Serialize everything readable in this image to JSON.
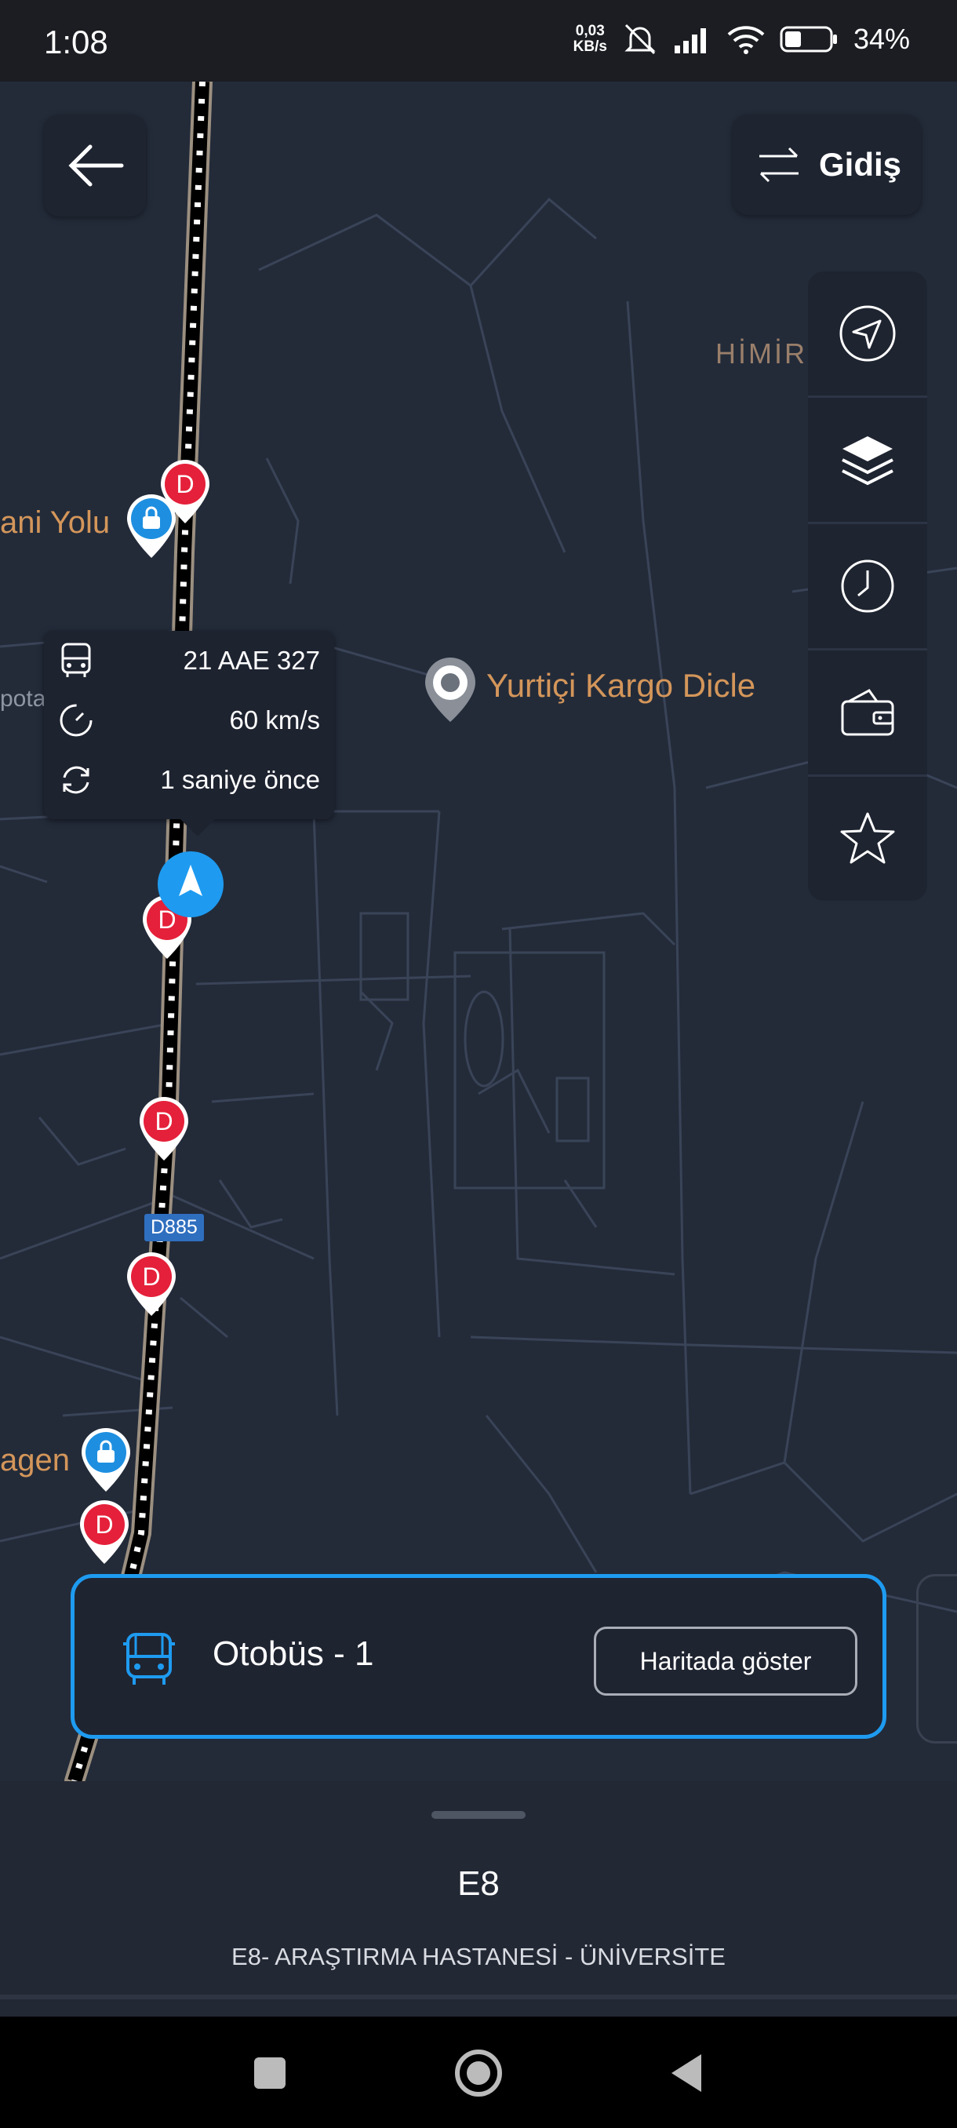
{
  "status_bar": {
    "time": "1:08",
    "net_speed_value": "0,03",
    "net_speed_unit": "KB/s",
    "battery": "34%"
  },
  "top_controls": {
    "direction_label": "Gidiş"
  },
  "map": {
    "road_labels": [
      "ani Yolu",
      "agen",
      "pota"
    ],
    "place_label": "Yurtiçi Kargo Dicle",
    "area_label": "HİMİR",
    "highway_shield": "D885",
    "stop_marker_letter": "D"
  },
  "vehicle_info": {
    "plate": "21 AAE 327",
    "speed": "60 km/s",
    "updated": "1 saniye önce"
  },
  "vehicle_card": {
    "name": "Otobüs - 1",
    "show_button": "Haritada göster"
  },
  "bottom_sheet": {
    "line_code": "E8",
    "route_name": "E8- ARAŞTIRMA HASTANESİ - ÜNİVERSİTE"
  },
  "colors": {
    "accent": "#1e9bf0",
    "stop_red": "#e5203a",
    "shop_blue": "#1e8fe0",
    "label_orange": "#d4965a"
  }
}
